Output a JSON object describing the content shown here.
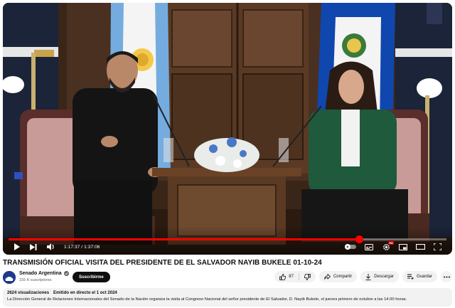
{
  "player": {
    "current_time": "1:17:37",
    "separator": " / ",
    "duration": "1:37:06",
    "progress_fraction": 0.8,
    "hd_badge": "HD",
    "icons": [
      "play-icon",
      "next-icon",
      "volume-icon",
      "autoplay-toggle-icon",
      "subtitles-icon",
      "settings-icon",
      "miniplayer-icon",
      "theater-icon",
      "fullscreen-icon"
    ]
  },
  "video": {
    "title": "TRANSMISIÓN OFICIAL VISITA DEL PRESIDENTE DE EL SALVADOR NAYIB BUKELE 01-10-24"
  },
  "channel": {
    "name": "Senado Argentina",
    "subscribers": "155 K suscriptores",
    "subscribe_label": "Suscribirme"
  },
  "actions": {
    "like_count": "87",
    "share_label": "Compartir",
    "download_label": "Descargar",
    "save_label": "Guardar"
  },
  "description": {
    "views": "2624 visualizaciones",
    "streamed": "Emitido en directo el 1 oct 2024",
    "text": "La Dirección General de Relaciones Internacionales del Senado de la Nación organiza la visita al Congreso Nacional del señor presidente de El Salvador, D. Nayib Bukele, el jueves primero de octubre a las 14.00 horas."
  },
  "colors": {
    "progress": "#ff0000",
    "subscribe_bg": "#0f0f0f",
    "pill_bg": "#f2f2f2",
    "flag_argentina_blue": "#74acdf",
    "flag_salvador_blue": "#0f47af",
    "jacket_green": "#1f5a3c"
  }
}
